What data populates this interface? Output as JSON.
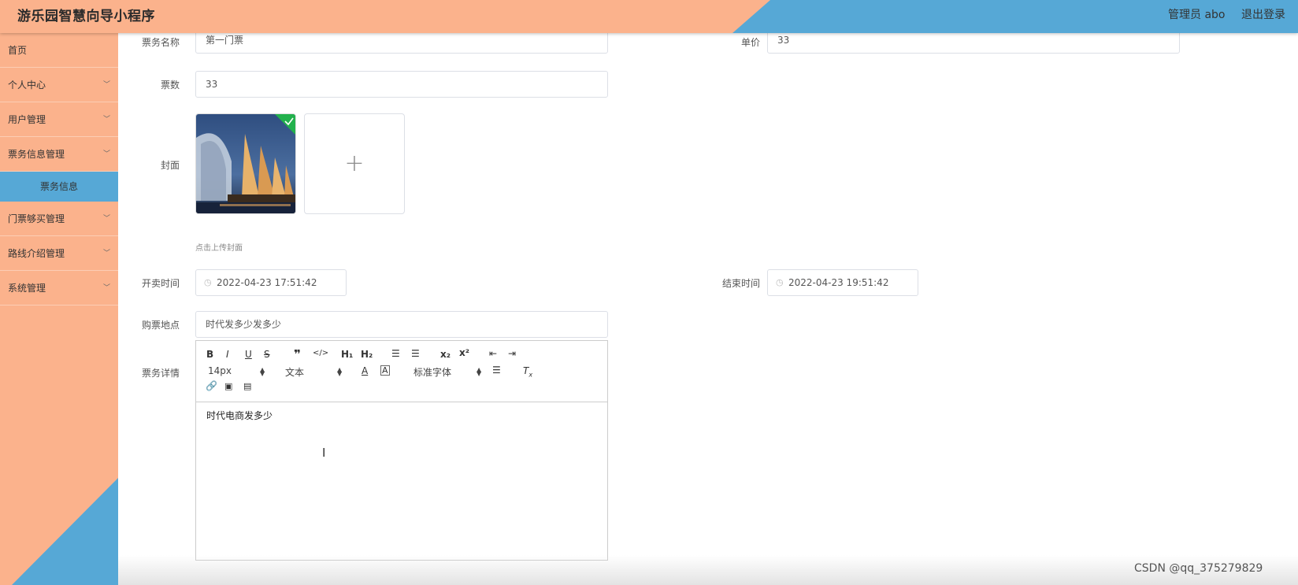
{
  "header": {
    "app_title": "游乐园智慧向导小程序",
    "user": "管理员 abo",
    "logout": "退出登录",
    "colors": {
      "salmon": "#fbb28c",
      "blue": "#56a8d6"
    }
  },
  "sidebar": {
    "items": [
      {
        "label": "首页",
        "has_chevron": false
      },
      {
        "label": "个人中心",
        "has_chevron": true
      },
      {
        "label": "用户管理",
        "has_chevron": true
      },
      {
        "label": "票务信息管理",
        "has_chevron": true
      }
    ],
    "active_sub": "票务信息",
    "items_after": [
      {
        "label": "门票够买管理",
        "has_chevron": true
      },
      {
        "label": "路线介绍管理",
        "has_chevron": true
      },
      {
        "label": "系统管理",
        "has_chevron": true
      }
    ]
  },
  "form": {
    "ticket_name_label": "票务名称",
    "ticket_name_value": "第一门票",
    "price_label": "单价",
    "price_value": "33",
    "count_label": "票数",
    "count_value": "33",
    "cover_label": "封面",
    "upload_hint": "点击上传封面",
    "start_label": "开卖时间",
    "start_value": "2022-04-23 17:51:42",
    "end_label": "结束时间",
    "end_value": "2022-04-23 19:51:42",
    "place_label": "购票地点",
    "place_value": "时代发多少发多少",
    "detail_label": "票务详情"
  },
  "editor": {
    "font_size": "14px",
    "text_type": "文本",
    "font_family": "标准字体",
    "content": "时代电商发多少"
  },
  "watermark": "CSDN @qq_375279829"
}
